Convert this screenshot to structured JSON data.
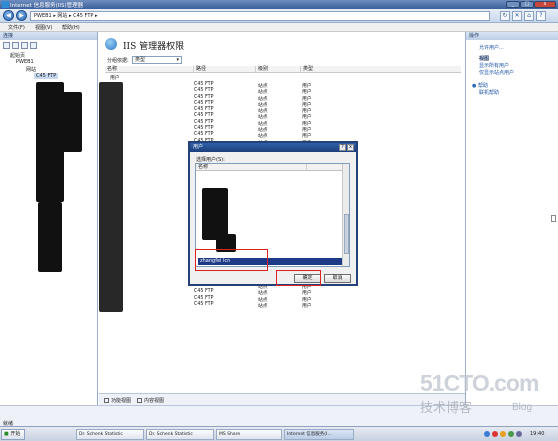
{
  "window": {
    "title": "Internet 信息服务(IIS)管理器"
  },
  "address": {
    "path": "PWEB1 ▸ 网站 ▸ C45 FTP ▸"
  },
  "menu": {
    "items": [
      "文件(F)",
      "视图(V)",
      "帮助(H)"
    ]
  },
  "connections": {
    "header": "连接",
    "tree_items": [
      "起始页",
      "PWEB1",
      "网站",
      "C45 FTP"
    ]
  },
  "center": {
    "title": "IIS 管理器权限",
    "group_label": "分组依据:",
    "group_value": "类型",
    "columns": [
      "名称",
      "路径",
      "级别",
      "类型"
    ],
    "first_row_name": "用户",
    "rows": [
      [
        "C45 FTP",
        "站点",
        "用户"
      ],
      [
        "C45 FTP",
        "站点",
        "用户"
      ],
      [
        "C45 FTP",
        "站点",
        "用户"
      ],
      [
        "C45 FTP",
        "站点",
        "用户"
      ],
      [
        "C45 FTP",
        "站点",
        "用户"
      ],
      [
        "C45 FTP",
        "站点",
        "用户"
      ],
      [
        "C45 FTP",
        "站点",
        "用户"
      ],
      [
        "C45 FTP",
        "站点",
        "用户"
      ],
      [
        "C45 FTP",
        "站点",
        "用户"
      ],
      [
        "C45 FTP",
        "站点",
        "用户"
      ],
      [
        "C45 FTP",
        "站点",
        "用户"
      ],
      [
        "C45 FTP",
        "站点",
        "用户"
      ],
      [
        "C45 FTP",
        "站点",
        "用户"
      ],
      [
        "C45 FTP",
        "站点",
        "用户"
      ],
      [
        "C45 FTP",
        "站点",
        "用户"
      ],
      [
        "C45 FTP",
        "站点",
        "用户"
      ],
      [
        "C45 FTP",
        "站点",
        "用户"
      ],
      [
        "C45 FTP",
        "站点",
        "用户"
      ],
      [
        "C45 FTP",
        "站点",
        "用户"
      ],
      [
        "C45 FTP",
        "站点",
        "用户"
      ],
      [
        "C45 FTP",
        "站点",
        "用户"
      ],
      [
        "C45 FTP",
        "站点",
        "用户"
      ],
      [
        "C45 FTP",
        "站点",
        "用户"
      ],
      [
        "C45 FTP",
        "站点",
        "用户"
      ],
      [
        "C45 FTP",
        "站点",
        "用户"
      ],
      [
        "C45 FTP",
        "站点",
        "用户"
      ],
      [
        "C45 FTP",
        "站点",
        "用户"
      ],
      [
        "C45 FTP",
        "站点",
        "用户"
      ],
      [
        "C45 FTP",
        "站点",
        "用户"
      ],
      [
        "C45 FTP",
        "站点",
        "用户"
      ],
      [
        "C45 FTP",
        "站点",
        "用户"
      ],
      [
        "C45 FTP",
        "站点",
        "用户"
      ],
      [
        "C45 FTP",
        "站点",
        "用户"
      ],
      [
        "C45 FTP",
        "站点",
        "用户"
      ],
      [
        "C45 FTP",
        "站点",
        "用户"
      ],
      [
        "C45 FTP",
        "站点",
        "用户"
      ]
    ],
    "tab_features": "功能视图",
    "tab_content": "内容视图"
  },
  "actions": {
    "header": "操作",
    "allow_user": "允许用户...",
    "view_header": "视图",
    "show_all_users": "显示所有用户",
    "allow_site_user": "仅显示站点用户",
    "help": "帮助",
    "online_help": "联机帮助"
  },
  "dialog": {
    "title": "用户",
    "label": "选择用户(S):",
    "column": "名称",
    "selected_user": "zhangfei lcn",
    "ok": "确定",
    "cancel": "取消"
  },
  "status": {
    "text": "就绪"
  },
  "taskbar": {
    "start": "开始",
    "tasks": [
      "Dr. Schenk Statistic",
      "Dr. Schenk Statistic",
      "MS Share",
      "Internet 信息服务(I..."
    ],
    "clock": "19:40"
  },
  "watermark": {
    "line1": "51CTO.com",
    "line2": "技术博客",
    "line3": "Blog"
  },
  "colors": {
    "titlebar": "#3c5f9a",
    "selection": "#1c3a86",
    "highlight_box": "#dd2222"
  }
}
